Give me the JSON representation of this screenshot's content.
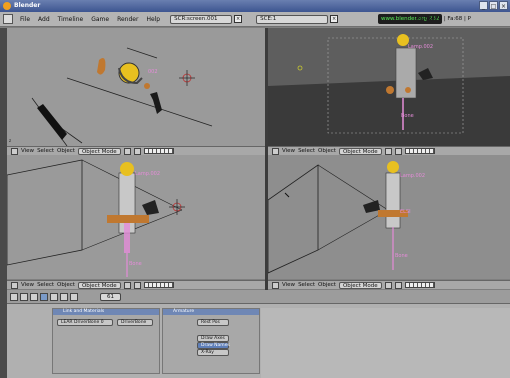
{
  "window": {
    "title": "Blender",
    "controls": [
      "_",
      "□",
      "×"
    ]
  },
  "menubar": {
    "items": [
      "File",
      "Add",
      "Timeline",
      "Game",
      "Render",
      "Help"
    ],
    "screen_field": "SCR:screen.001",
    "scene_field": "SCE:1",
    "url": "www.blender.org 232",
    "stats": "Ve:52670 | Fa:68 | P"
  },
  "viewport_header": {
    "view": "View",
    "select": "Select",
    "object": "Object",
    "mode": "Object Mode"
  },
  "viewport_labels": {
    "top_left_name": "002",
    "top_right_name": "Lamp.002",
    "top_right_bone": "Bone",
    "bottom_left_name": "Lamp.002",
    "bottom_left_bone": "Bone",
    "bottom_right_name": "Lamp.002",
    "bottom_right_name2": "ELSI",
    "bottom_right_bone": "Bone"
  },
  "buttons_window": {
    "frame": "61",
    "panel1_title": "Link and Materials",
    "panel1_field1": "LEAR DriverBone 0",
    "panel1_field2": "DriverBone",
    "panel2_title": "Armature",
    "panel2_btn_rest": "Rest Pos",
    "panel2_btn_draw_axes": "Draw Axes",
    "panel2_btn_draw_names": "Draw Names",
    "panel2_btn_xray": "X-Ray"
  },
  "colors": {
    "title_bar": "#3d5590",
    "bone_pink": "#e48cd8",
    "lamp_yellow": "#e8c020"
  }
}
